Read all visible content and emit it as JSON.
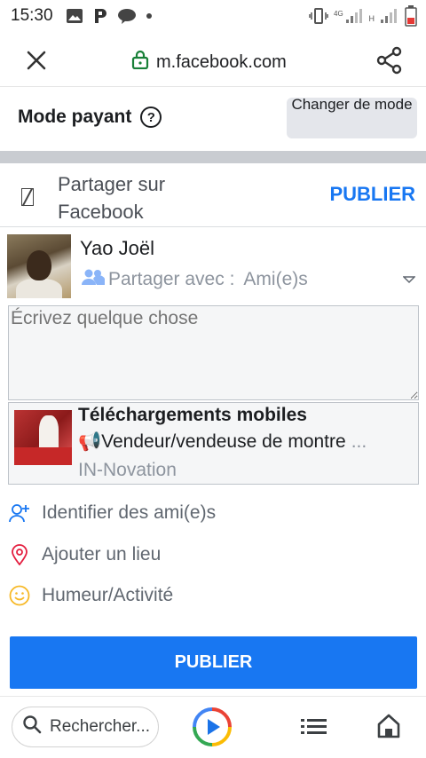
{
  "status_bar": {
    "time": "15:30",
    "network_label": "H"
  },
  "browser": {
    "url": "m.facebook.com"
  },
  "mode": {
    "title": "Mode payant",
    "change_label": "Changer de mode"
  },
  "share": {
    "title": "Partager sur Facebook",
    "publish_label": "PUBLIER"
  },
  "author": {
    "name": "Yao Joël",
    "audience_prefix": "Partager avec :",
    "audience_value": "Ami(e)s"
  },
  "composer": {
    "placeholder": "Écrivez quelque chose"
  },
  "attachment": {
    "title": "Téléchargements mobiles",
    "description": "📢Vendeur/vendeuse de montre",
    "ellipsis": "...",
    "source": "IN-Novation"
  },
  "actions": [
    {
      "label": "Identifier des ami(e)s",
      "icon": "tag-friends-icon",
      "color": "#1877f2"
    },
    {
      "label": "Ajouter un lieu",
      "icon": "location-pin-icon",
      "color": "#e41e3f"
    },
    {
      "label": "Humeur/Activité",
      "icon": "smiley-icon",
      "color": "#f7b928"
    }
  ],
  "publish_main": {
    "label": "PUBLIER"
  },
  "bottom_bar": {
    "search_label": "Rechercher..."
  },
  "colors": {
    "accent": "#1877f2",
    "band": "#c9ccd1",
    "secondary_text": "#8d949e"
  }
}
